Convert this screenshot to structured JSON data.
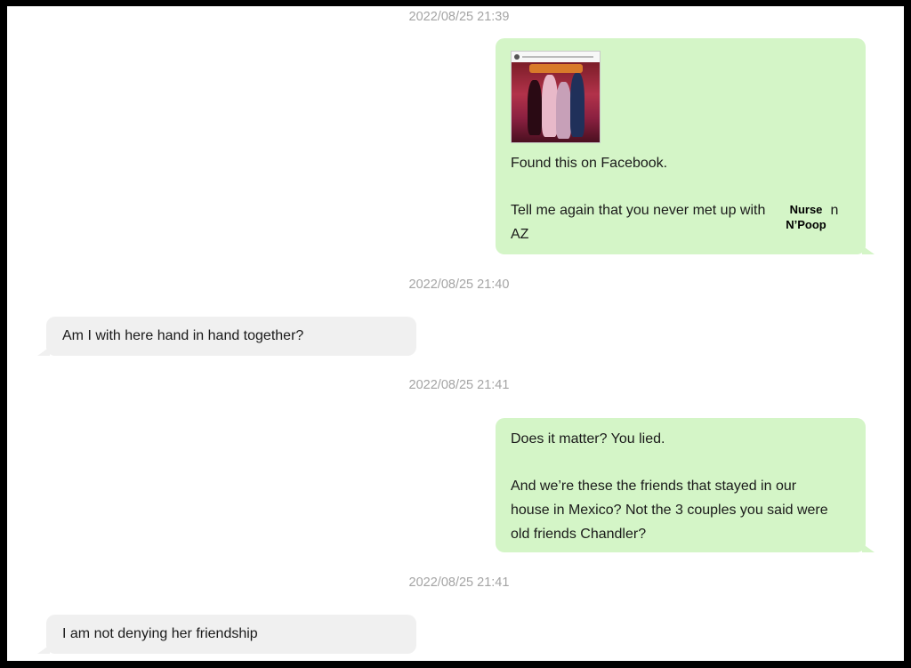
{
  "messages": [
    {
      "timestamp": "2022/08/25 21:39",
      "sent": {
        "image": "shared-facebook-photo",
        "lines": [
          "Found this on Facebook.",
          "Tell me again that you never met up with",
          "in",
          "AZ"
        ],
        "overlay": [
          "Nurse",
          "N’Poop"
        ]
      }
    },
    {
      "timestamp": "2022/08/25 21:40",
      "received": {
        "text": "Am I with here hand in hand together?"
      }
    },
    {
      "timestamp": "2022/08/25 21:41",
      "sent": {
        "lines": [
          "Does it matter? You lied.",
          "And we’re these the friends that stayed in our",
          "house in Mexico? Not the 3 couples you said were",
          "old friends Chandler?"
        ]
      }
    },
    {
      "timestamp": "2022/08/25 21:41",
      "received": {
        "text": "I am not denying her friendship"
      }
    }
  ],
  "colors": {
    "sent_bubble": "#d4f5c7",
    "received_bubble": "#f0f0f0",
    "timestamp": "#a4a4a4",
    "frame": "#000000"
  }
}
